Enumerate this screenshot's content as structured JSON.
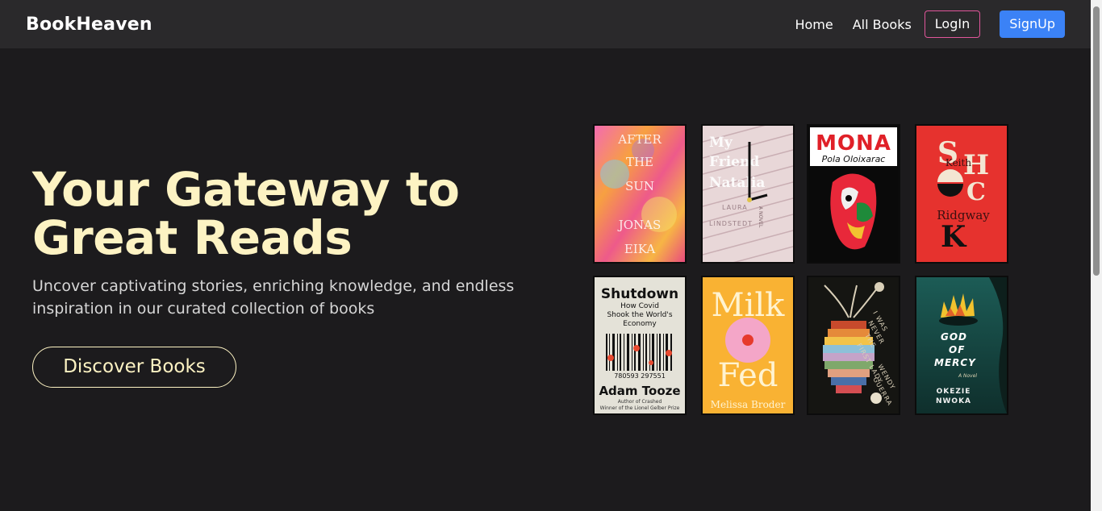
{
  "nav": {
    "brand": "BookHeaven",
    "links": [
      "Home",
      "All Books"
    ],
    "login": "LogIn",
    "signup": "SignUp"
  },
  "hero": {
    "title_line1": "Your Gateway to",
    "title_line2": "Great Reads",
    "subtitle_line1": "Uncover captivating stories, enriching knowledge, and endless",
    "subtitle_line2": "inspiration in our curated collection of books",
    "cta": "Discover Books"
  },
  "books": [
    {
      "title": "AFTER THE SUN",
      "author": "JONAS EIKA"
    },
    {
      "title": "My Friend Natalia",
      "author": "LAURA LINDSTEDT",
      "tag": "A NOVEL"
    },
    {
      "title": "MONA",
      "author": "Pola Oloixarac"
    },
    {
      "title": "SHOCK",
      "author": "Keith Ridgway"
    },
    {
      "title": "Shutdown",
      "subtitle": "How Covid Shook the World's Economy",
      "author": "Adam Tooze",
      "barcode": "780593 297551",
      "footnote1": "Author of Crashed",
      "footnote2": "Winner of the Lionel Gelber Prize"
    },
    {
      "title": "Milk Fed",
      "author": "Melissa Broder"
    },
    {
      "title": "I WAS NEVER THE FIRST LADY",
      "author": "WENDY GUERRA"
    },
    {
      "title": "GOD OF MERCY",
      "author": "OKEZIE NWOKA",
      "tag": "A Novel"
    }
  ],
  "colors": {
    "background": "#1c1b1d",
    "navbar": "#2a292b",
    "accent_cream": "#fdf3c3",
    "login_border": "#e0569a",
    "signup_bg": "#3b82f6"
  }
}
